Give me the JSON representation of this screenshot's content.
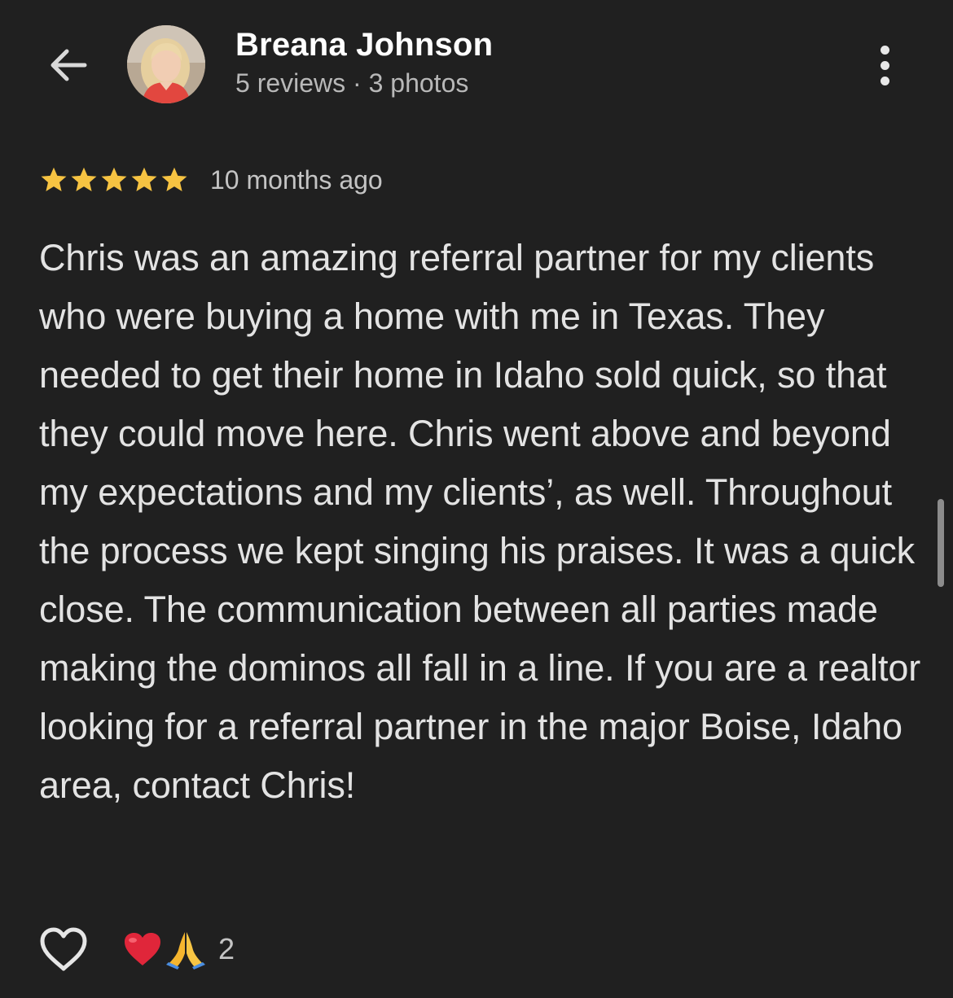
{
  "header": {
    "back_icon": "arrow-left-icon",
    "author_name": "Breana Johnson",
    "author_meta": "5 reviews · 3 photos",
    "menu_icon": "more-vertical-icon"
  },
  "review": {
    "rating": 5,
    "rating_max": 5,
    "star_color": "#F6C342",
    "time": "10 months ago",
    "text": "Chris was an amazing referral partner for my clients who were buying a home with me in Texas. They needed to get their home in Idaho sold quick, so that they could move here. Chris went above and beyond my expectations and my clients’, as well. Throughout the process we kept singing his praises. It was a quick close. The communication between all parties made making the dominos all fall in a line. If you are a realtor looking for a referral partner in the major Boise, Idaho area, contact Chris!"
  },
  "actions": {
    "like_icon": "heart-outline-icon",
    "reaction_icons": [
      "red-heart-icon",
      "praying-hands-icon"
    ],
    "reaction_count": "2"
  },
  "colors": {
    "background": "#202020",
    "text": "#E3E3E3",
    "secondary_text": "#B8B8B8",
    "heart_red": "#E0263A"
  }
}
